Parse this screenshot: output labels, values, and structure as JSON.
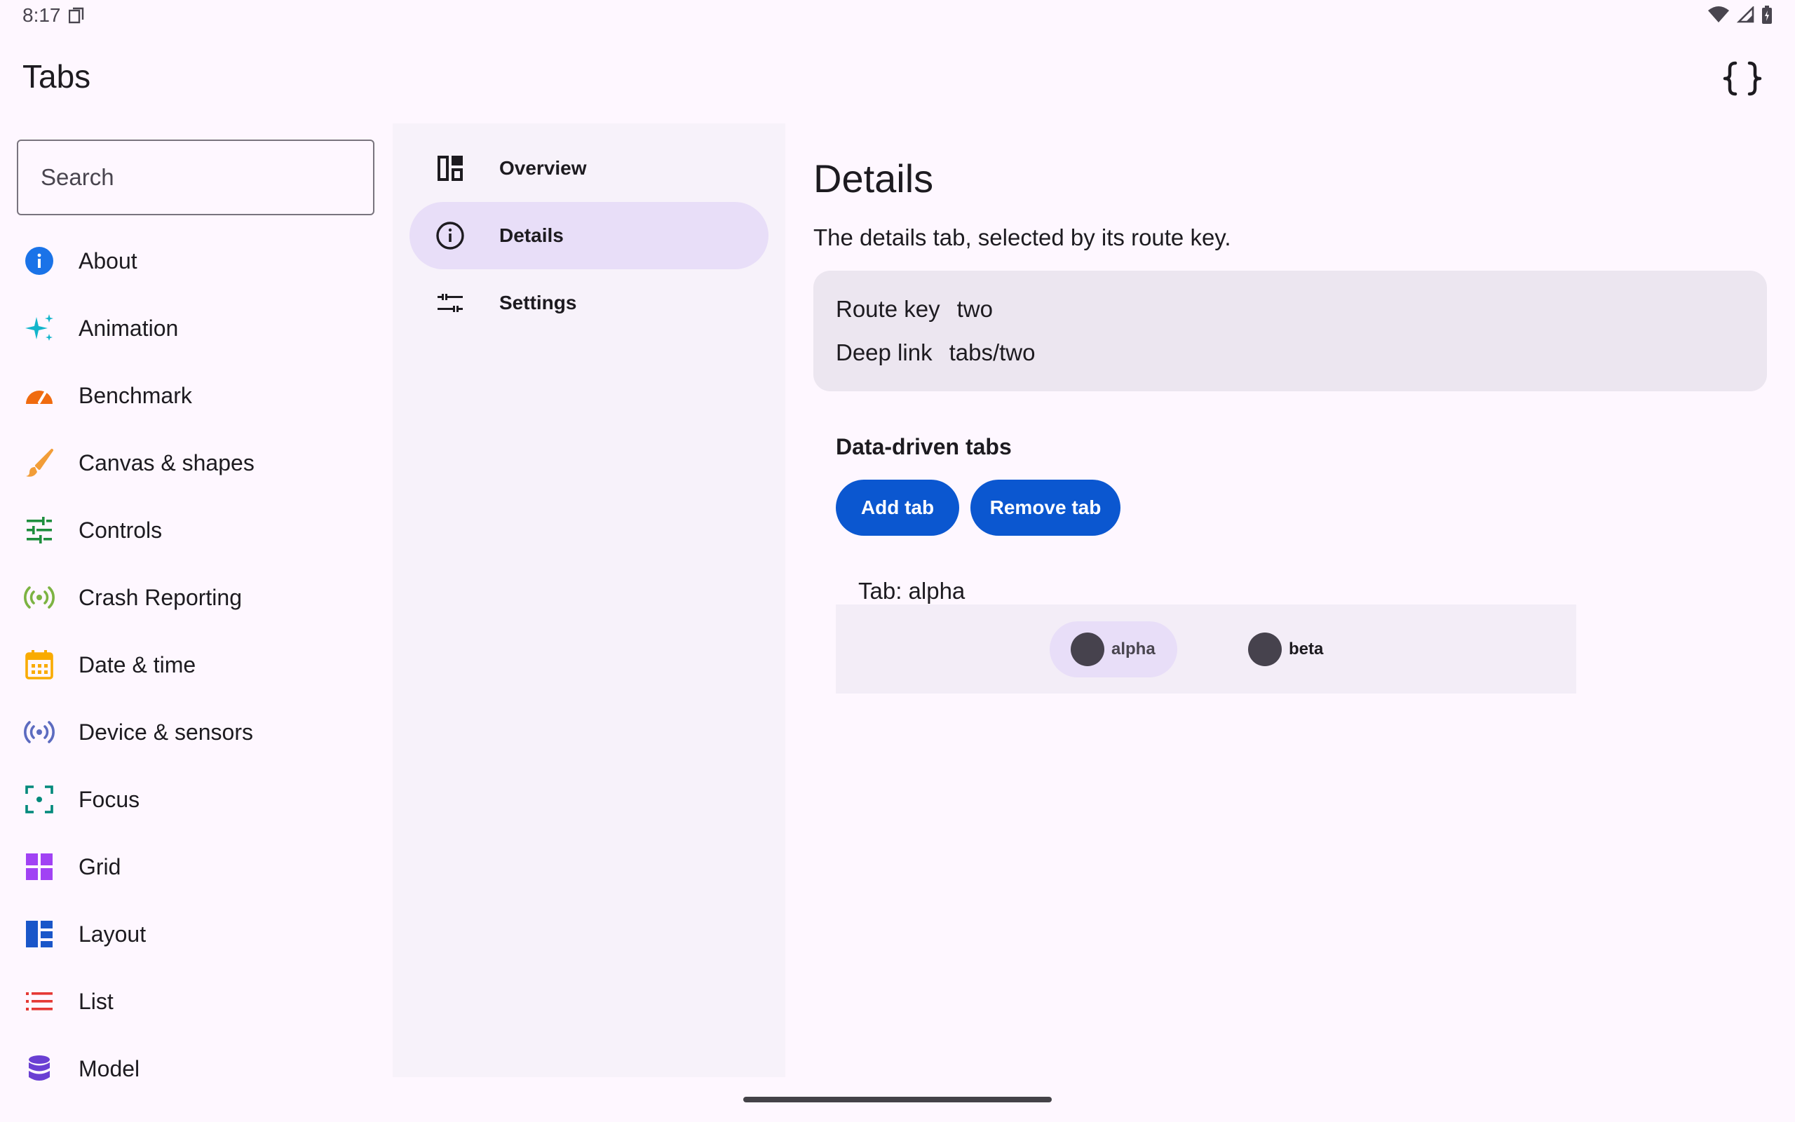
{
  "status_bar": {
    "time": "8:17"
  },
  "app_bar": {
    "title": "Tabs"
  },
  "search": {
    "placeholder": "Search"
  },
  "nav_items": [
    {
      "label": "About",
      "icon": "info-icon",
      "color": "#1a73e8"
    },
    {
      "label": "Animation",
      "icon": "sparkle-icon",
      "color": "#12b5cb"
    },
    {
      "label": "Benchmark",
      "icon": "speedometer-icon",
      "color": "#f06b0f"
    },
    {
      "label": "Canvas & shapes",
      "icon": "brush-icon",
      "color": "#f29d38"
    },
    {
      "label": "Controls",
      "icon": "tune-icon",
      "color": "#1e8e3e"
    },
    {
      "label": "Crash Reporting",
      "icon": "broadcast-icon",
      "color": "#7cb342"
    },
    {
      "label": "Date & time",
      "icon": "calendar-icon",
      "color": "#f9ab00"
    },
    {
      "label": "Device & sensors",
      "icon": "sensors-icon",
      "color": "#5c6bc0"
    },
    {
      "label": "Focus",
      "icon": "focus-icon",
      "color": "#00897b"
    },
    {
      "label": "Grid",
      "icon": "grid-icon",
      "color": "#a142f4"
    },
    {
      "label": "Layout",
      "icon": "layout-icon",
      "color": "#1a56c9"
    },
    {
      "label": "List",
      "icon": "list-icon",
      "color": "#e53935"
    },
    {
      "label": "Model",
      "icon": "database-icon",
      "color": "#6a3fd3"
    }
  ],
  "tabs": [
    {
      "label": "Overview",
      "icon": "dashboard-icon",
      "selected": false
    },
    {
      "label": "Details",
      "icon": "info-outline-icon",
      "selected": true
    },
    {
      "label": "Settings",
      "icon": "settings-sliders-icon",
      "selected": false
    }
  ],
  "detail": {
    "title": "Details",
    "description": "The details tab, selected by its route key.",
    "route_key_label": "Route key",
    "route_key_value": "two",
    "deep_link_label": "Deep link",
    "deep_link_value": "tabs/two",
    "section_title": "Data-driven tabs",
    "add_button": "Add tab",
    "remove_button": "Remove tab",
    "current_tab_caption": "Tab: alpha",
    "dynamic_tabs": [
      {
        "label": "alpha",
        "active": true
      },
      {
        "label": "beta",
        "active": false
      }
    ]
  },
  "colors": {
    "primary": "#0b57d0",
    "selected_tab": "#e8def8",
    "card": "#ece6f0"
  }
}
